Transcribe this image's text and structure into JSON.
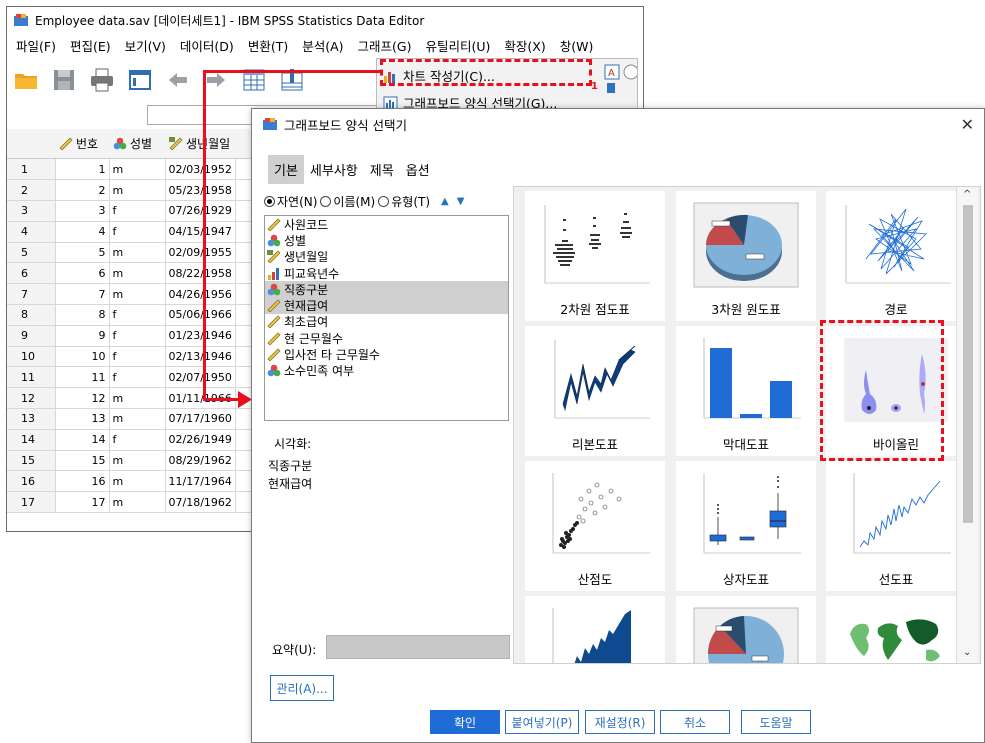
{
  "spss": {
    "title": "Employee data.sav [데이터세트1] - IBM SPSS Statistics Data Editor",
    "menu": [
      "파일(F)",
      "편집(E)",
      "보기(V)",
      "데이터(D)",
      "변환(T)",
      "분석(A)",
      "그래프(G)",
      "유틸리티(U)",
      "확장(X)",
      "창(W)"
    ],
    "columns": [
      "번호",
      "성별",
      "생년월일"
    ],
    "rows": [
      [
        "1",
        "1",
        "m",
        "02/03/1952"
      ],
      [
        "2",
        "2",
        "m",
        "05/23/1958"
      ],
      [
        "3",
        "3",
        "f",
        "07/26/1929"
      ],
      [
        "4",
        "4",
        "f",
        "04/15/1947"
      ],
      [
        "5",
        "5",
        "m",
        "02/09/1955"
      ],
      [
        "6",
        "6",
        "m",
        "08/22/1958"
      ],
      [
        "7",
        "7",
        "m",
        "04/26/1956"
      ],
      [
        "8",
        "8",
        "f",
        "05/06/1966"
      ],
      [
        "9",
        "9",
        "f",
        "01/23/1946"
      ],
      [
        "10",
        "10",
        "f",
        "02/13/1946"
      ],
      [
        "11",
        "11",
        "f",
        "02/07/1950"
      ],
      [
        "12",
        "12",
        "m",
        "01/11/1966"
      ],
      [
        "13",
        "13",
        "m",
        "07/17/1960"
      ],
      [
        "14",
        "14",
        "f",
        "02/26/1949"
      ],
      [
        "15",
        "15",
        "m",
        "08/29/1962"
      ],
      [
        "16",
        "16",
        "m",
        "11/17/1964"
      ],
      [
        "17",
        "17",
        "m",
        "07/18/1962"
      ]
    ]
  },
  "graph_menu": {
    "chart_builder": "차트 작성기(C)...",
    "template_chooser": "그래프보드 양식 선택기(G)...",
    "badge": "1"
  },
  "dialog": {
    "title": "그래프보드 양식 선택기",
    "tabs": [
      "기본",
      "세부사항",
      "제목",
      "옵션"
    ],
    "sort": {
      "natural": "자연(N)",
      "name": "이름(M)",
      "type": "유형(T)"
    },
    "variables": [
      {
        "label": "사원코드",
        "icon": "scale-ruler-icon",
        "selected": false
      },
      {
        "label": "성별",
        "icon": "nominal-icon",
        "selected": false
      },
      {
        "label": "생년월일",
        "icon": "date-ruler-icon",
        "selected": false
      },
      {
        "label": "피교육년수",
        "icon": "ordinal-icon",
        "selected": false
      },
      {
        "label": "직종구분",
        "icon": "nominal-icon",
        "selected": true
      },
      {
        "label": "현재급여",
        "icon": "scale-ruler-icon",
        "selected": true
      },
      {
        "label": "최초급여",
        "icon": "scale-ruler-icon",
        "selected": false
      },
      {
        "label": "현 근무월수",
        "icon": "scale-ruler-icon",
        "selected": false
      },
      {
        "label": "입사전 타 근무월수",
        "icon": "scale-ruler-icon",
        "selected": false
      },
      {
        "label": "소수민족 여부",
        "icon": "nominal-icon",
        "selected": false
      }
    ],
    "visualization_label": "시각화:",
    "visualization_items": [
      "직종구분",
      "현재급여"
    ],
    "summary_label": "요약(U):",
    "manage_button": "관리(A)...",
    "gallery": [
      "2차원 점도표",
      "3차원 원도표",
      "경로",
      "리본도표",
      "막대도표",
      "바이올린",
      "산점도",
      "상자도표",
      "선도표"
    ],
    "buttons": {
      "ok": "확인",
      "paste": "붙여넣기(P)",
      "reset": "재설정(R)",
      "cancel": "취소",
      "help": "도움말"
    }
  },
  "colors": {
    "highlight": "#e8101c",
    "accent": "#1f6cd6",
    "selection": "#cfcfcf"
  }
}
